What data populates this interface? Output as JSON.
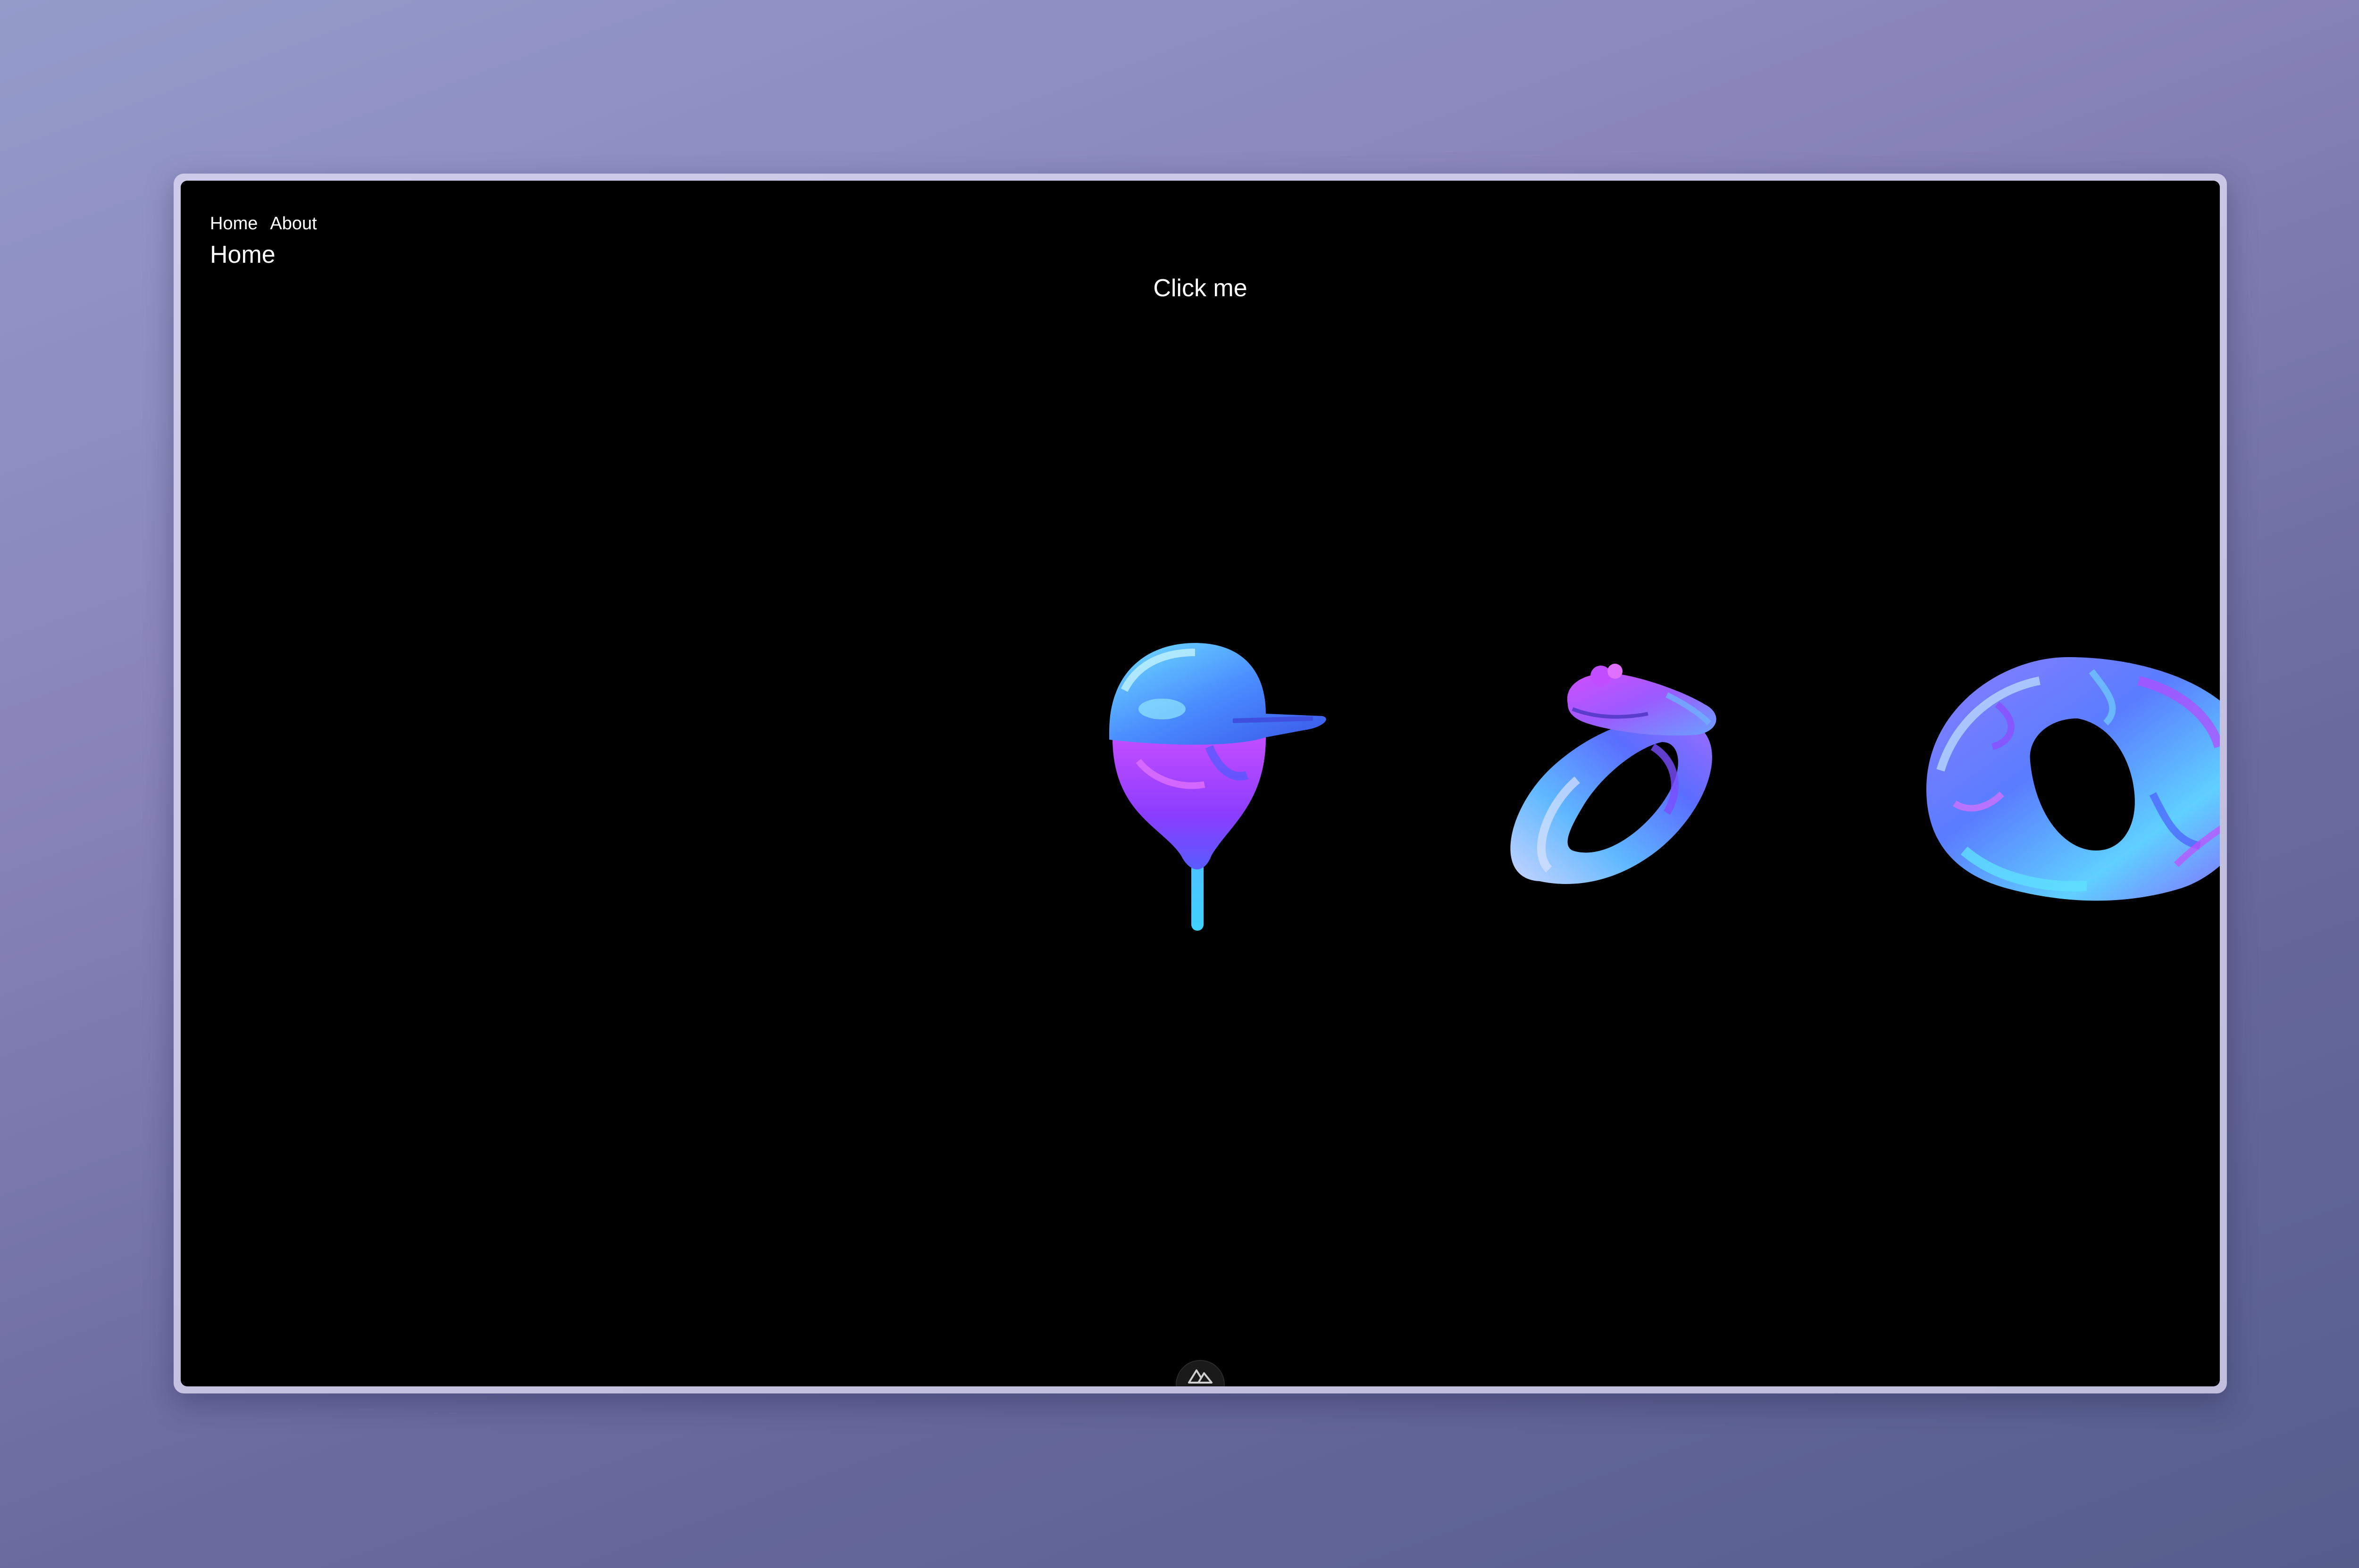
{
  "nav": {
    "items": [
      {
        "label": "Home"
      },
      {
        "label": "About"
      }
    ]
  },
  "page": {
    "heading": "Home"
  },
  "action": {
    "label": "Click me"
  },
  "scene": {
    "objects": [
      {
        "icon": "capped-balloon-icon"
      },
      {
        "icon": "frog-ring-icon"
      },
      {
        "icon": "ornate-ring-icon"
      }
    ],
    "colors": {
      "cyan": "#5fd4ff",
      "blue": "#4a6dff",
      "violet": "#9b4dff",
      "magenta": "#d24dff",
      "light": "#b9c8ff"
    }
  },
  "devtools": {
    "icon": "nuxt-logo-icon"
  }
}
